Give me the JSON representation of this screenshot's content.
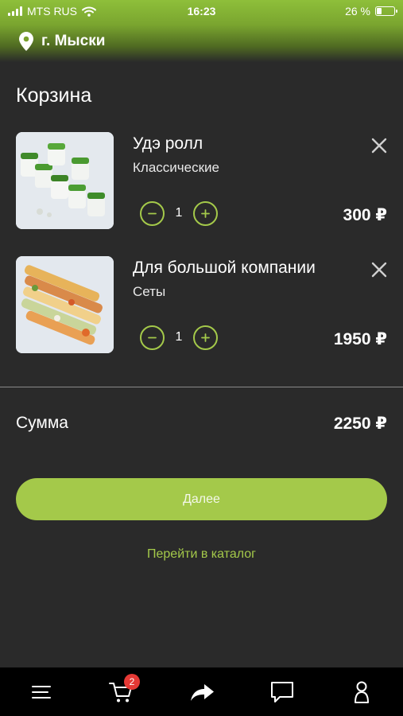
{
  "status_bar": {
    "carrier": "MTS RUS",
    "time": "16:23",
    "battery": "26 %",
    "battery_level": 0.26
  },
  "header": {
    "city": "г. Мыски",
    "location_icon": "location-pin-icon"
  },
  "cart": {
    "title": "Корзина",
    "items": [
      {
        "name": "Удэ ролл",
        "category": "Классические",
        "quantity": "1",
        "price": "300 ₽"
      },
      {
        "name": "Для большой компании",
        "category": "Сеты",
        "quantity": "1",
        "price": "1950 ₽"
      }
    ],
    "sum_label": "Сумма",
    "sum_value": "2250 ₽",
    "next_label": "Далее",
    "catalog_link": "Перейти в каталог"
  },
  "tab_bar": {
    "items": [
      "menu-icon",
      "cart-icon",
      "share-icon",
      "chat-icon",
      "profile-icon"
    ],
    "cart_badge": "2"
  },
  "colors": {
    "accent": "#a4c94a",
    "background": "#2a2a2a",
    "tab_bar": "#000000",
    "badge": "#e53935"
  }
}
